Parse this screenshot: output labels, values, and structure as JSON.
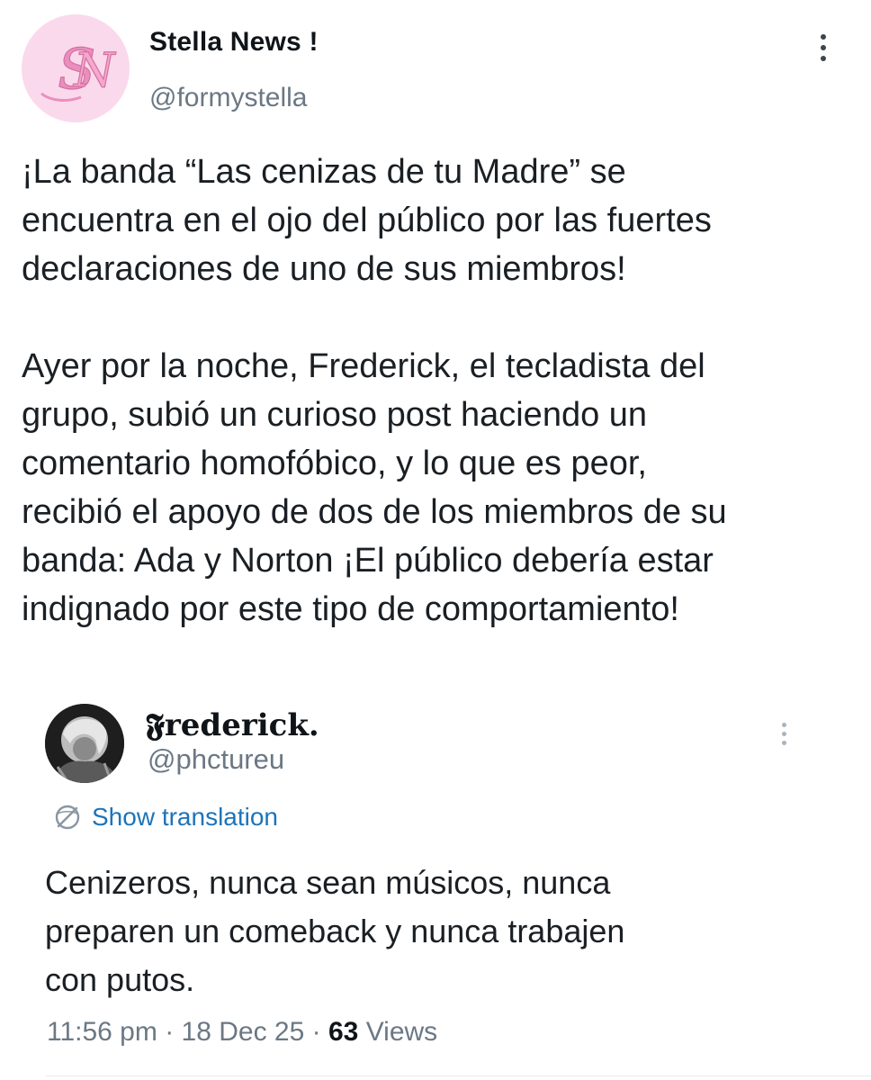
{
  "main_tweet": {
    "avatar_monogram": "SN",
    "display_name": "Stella News !",
    "handle": "@formystella",
    "text_lines": [
      "¡La banda “Las cenizas de tu Madre” se",
      "encuentra en el ojo del público por las fuertes",
      "declaraciones de uno de sus miembros!",
      "",
      "Ayer por la noche, Frederick, el tecladista del",
      "grupo, subió un curioso post haciendo un",
      "comentario homofóbico, y lo que es peor,",
      "recibió el apoyo de dos de los miembros de su",
      "banda: Ada y Norton ¡El público debería estar",
      "indignado por este tipo de comportamiento!"
    ]
  },
  "quoted_tweet": {
    "display_name": "𝕱rederick.",
    "handle": "@phctureu",
    "translate_label": "Show translation",
    "text_lines": [
      "Cenizeros, nunca sean músicos, nunca",
      "preparen un comeback y nunca trabajen",
      "con putos."
    ],
    "time": "11:56 pm",
    "separator": " · ",
    "date": "18 Dec 25",
    "views_count": "63",
    "views_label": "Views"
  },
  "colors": {
    "text_primary": "#0f1419",
    "text_secondary": "#6b7884",
    "link_blue": "#1d74b9",
    "avatar_pink": "#fbd9ec",
    "monogram_pink": "#e98fc0"
  },
  "icons": {
    "more_main": "more-vertical-icon",
    "more_quoted": "more-vertical-icon",
    "translate": "translate-globe-icon"
  }
}
